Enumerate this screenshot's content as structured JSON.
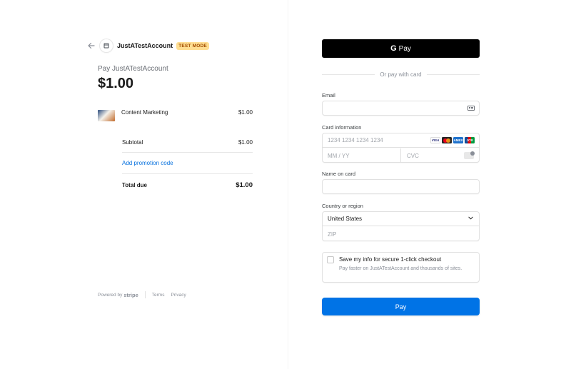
{
  "merchant": {
    "name": "JustATestAccount",
    "test_badge": "TEST MODE"
  },
  "summary": {
    "pay_label": "Pay JustATestAccount",
    "amount": "$1.00",
    "items": [
      {
        "name": "Content Marketing",
        "price": "$1.00"
      }
    ],
    "subtotal_label": "Subtotal",
    "subtotal_value": "$1.00",
    "promo_link": "Add promotion code",
    "total_label": "Total due",
    "total_value": "$1.00"
  },
  "footer": {
    "powered_by": "Powered by",
    "brand": "stripe",
    "terms": "Terms",
    "privacy": "Privacy"
  },
  "payment": {
    "gpay_label": "Pay",
    "gpay_g": "G",
    "divider_text": "Or pay with card",
    "email_label": "Email",
    "email_value": "",
    "card_label": "Card information",
    "card_number_placeholder": "1234 1234 1234 1234",
    "card_brands": [
      "VISA",
      "Mastercard",
      "AMEX",
      "JCB"
    ],
    "brand_visa_text": "VISA",
    "brand_amex_text": "AMEX",
    "brand_jcb_text": "JCB",
    "expiry_placeholder": "MM / YY",
    "cvc_placeholder": "CVC",
    "name_label": "Name on card",
    "name_value": "",
    "country_label": "Country or region",
    "country_value": "United States",
    "zip_placeholder": "ZIP",
    "save_title": "Save my info for secure 1-click checkout",
    "save_desc": "Pay faster on JustATestAccount and thousands of sites.",
    "save_checked": false,
    "pay_button": "Pay"
  },
  "colors": {
    "accent": "#0073e6",
    "link": "#0570de",
    "test_badge_bg": "#ffde92",
    "test_badge_text": "#a14b00",
    "gpay_bg": "#000000"
  }
}
